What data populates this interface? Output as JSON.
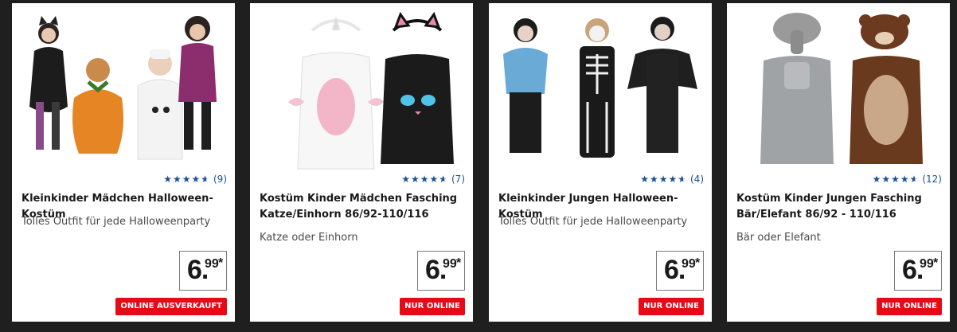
{
  "products": [
    {
      "title": "Kleinkinder Mädchen Halloween-Kostüm",
      "subtitle": "Tolles Outfit für jede Halloweenparty",
      "rating_count": "(9)",
      "rating_value": 4.5,
      "price_int": "6.",
      "price_dec": "99",
      "price_star": "*",
      "badge": "ONLINE AUSVERKAUFT",
      "image_icon": "girls-halloween-costumes-image"
    },
    {
      "title": "Kostüm Kinder Mädchen Fasching Katze/Einhorn 86/92-110/116",
      "subtitle": "Katze oder Einhorn",
      "rating_count": "(7)",
      "rating_value": 4.5,
      "price_int": "6.",
      "price_dec": "99",
      "price_star": "*",
      "badge": "NUR ONLINE",
      "image_icon": "cat-unicorn-costume-image"
    },
    {
      "title": "Kleinkinder Jungen Halloween-Kostüm",
      "subtitle": "Tolles Outfit für jede Halloweenparty",
      "rating_count": "(4)",
      "rating_value": 4.5,
      "price_int": "6.",
      "price_dec": "99",
      "price_star": "*",
      "badge": "NUR ONLINE",
      "image_icon": "boys-halloween-costumes-image"
    },
    {
      "title": "Kostüm Kinder Jungen Fasching Bär/Elefant 86/92 - 110/116",
      "subtitle": "Bär oder Elefant",
      "rating_count": "(12)",
      "rating_value": 4.5,
      "price_int": "6.",
      "price_dec": "99",
      "price_star": "*",
      "badge": "NUR ONLINE",
      "image_icon": "bear-elephant-costume-image"
    }
  ],
  "colors": {
    "background": "#1f1f1f",
    "card": "#ffffff",
    "star": "#1a4f95",
    "badge": "#e60a14"
  }
}
